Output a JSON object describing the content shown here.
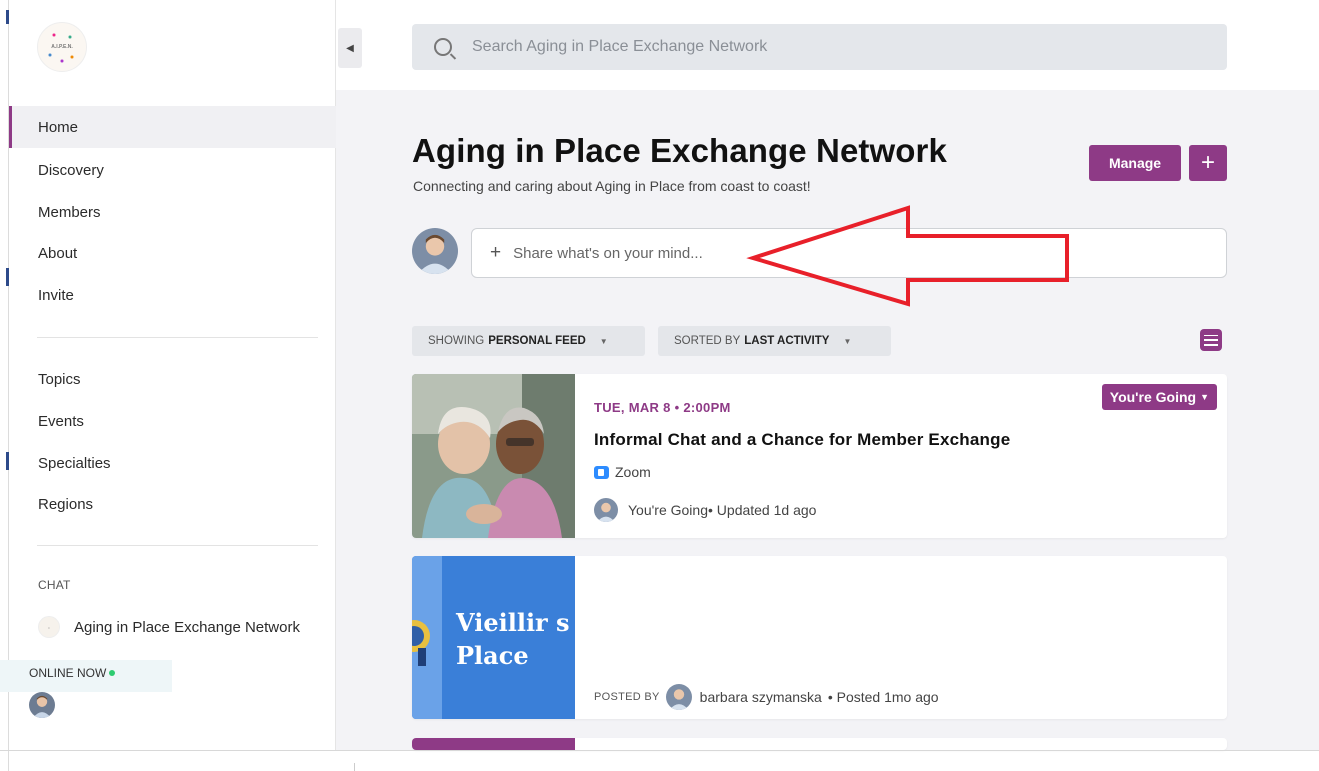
{
  "sidebar": {
    "logo_text": "A.I.P.E.N.",
    "nav_items": [
      {
        "label": "Home",
        "active": true
      },
      {
        "label": "Discovery"
      },
      {
        "label": "Members"
      },
      {
        "label": "About"
      },
      {
        "label": "Invite"
      }
    ],
    "secondary_items": [
      {
        "label": "Topics"
      },
      {
        "label": "Events"
      },
      {
        "label": "Specialties"
      },
      {
        "label": "Regions"
      }
    ],
    "chat_label": "CHAT",
    "chat_item": "Aging in Place Exchange Network",
    "online_label": "ONLINE NOW"
  },
  "search": {
    "placeholder": "Search Aging in Place Exchange Network"
  },
  "header": {
    "title": "Aging in Place Exchange Network",
    "subtitle": "Connecting and caring about Aging in Place from coast to coast!",
    "manage_label": "Manage",
    "add_label": "+"
  },
  "composer": {
    "plus": "+",
    "placeholder": "Share what's on your mind..."
  },
  "filters": {
    "feed_prefix": "SHOWING",
    "feed_value": "PERSONAL FEED",
    "sort_prefix": "SORTED BY",
    "sort_value": "LAST ACTIVITY",
    "caret": "▼"
  },
  "event_card": {
    "date": "TUE, MAR 8 • 2:00PM",
    "title": "Informal Chat and a Chance for Member Exchange",
    "location": "Zoom",
    "status": "You're Going",
    "updated": " • Updated 1d ago",
    "badge_label": "You're Going",
    "badge_caret": "▼"
  },
  "post_card": {
    "image_text_line1": "Vieillir s",
    "image_text_line2": "Place",
    "posted_by_label": "POSTED BY",
    "author": "barbara szymanska",
    "posted": " • Posted 1mo ago"
  },
  "colors": {
    "accent": "#8e3a86",
    "annotation_arrow": "#e8202a",
    "online": "#2ecc71",
    "zoom": "#2d8cff"
  },
  "icons": [
    "search-icon",
    "collapse-sidebar-icon",
    "plus-icon",
    "list-view-icon",
    "zoom-icon",
    "chevron-down-icon",
    "annotation-arrow"
  ]
}
